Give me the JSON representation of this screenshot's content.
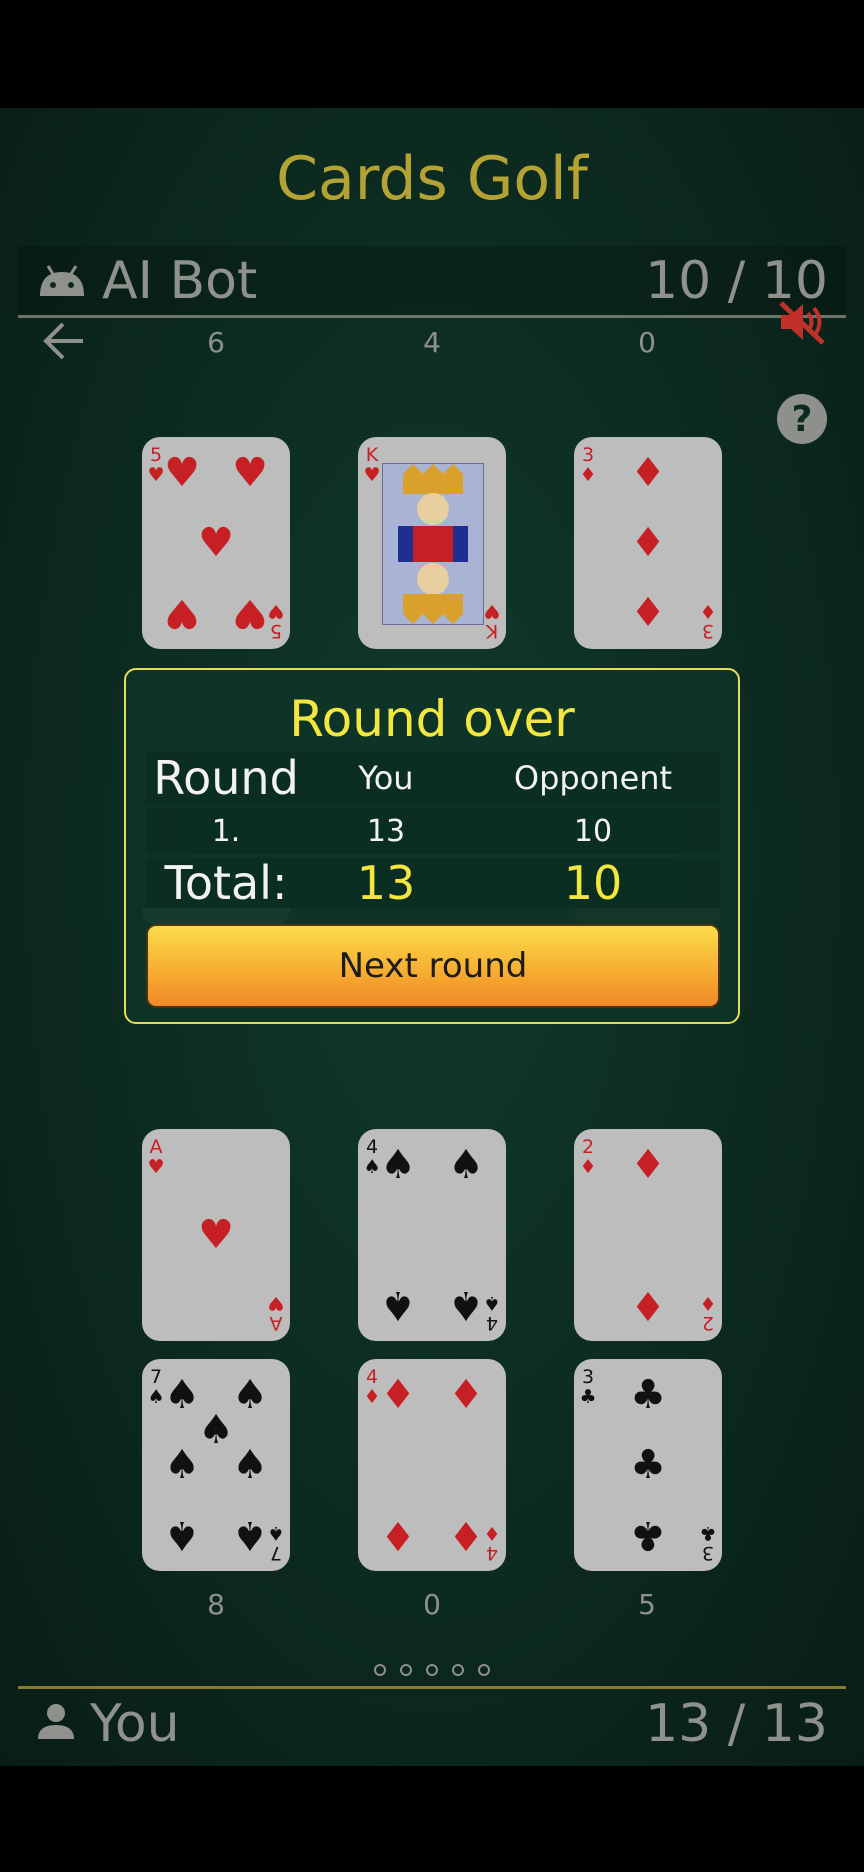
{
  "title": "Cards Golf",
  "opponent": {
    "name": "AI Bot",
    "score": "10 / 10"
  },
  "player": {
    "name": "You",
    "score": "13 / 13"
  },
  "opponent_columns": [
    "6",
    "4",
    "0"
  ],
  "player_columns": [
    "8",
    "0",
    "5"
  ],
  "icons": {
    "back": "arrow-left-icon",
    "sound": "volume-muted-icon",
    "help": "question-mark-icon",
    "bot": "android-icon",
    "user": "person-icon"
  },
  "colors": {
    "title": "#b5a235",
    "muted_icon": "#c2302a",
    "highlight": "#f3e640",
    "button_top": "#fbdc4a",
    "button_bottom": "#f08a2a"
  },
  "opponent_cards": [
    {
      "rank": "5",
      "suit": "♥"
    },
    {
      "rank": "K",
      "suit": "♥"
    },
    {
      "rank": "3",
      "suit": "♦"
    }
  ],
  "player_cards_row2": [
    {
      "rank": "A",
      "suit": "♥"
    },
    {
      "rank": "4",
      "suit": "♠"
    },
    {
      "rank": "2",
      "suit": "♦"
    }
  ],
  "player_cards_row3": [
    {
      "rank": "7",
      "suit": "♠"
    },
    {
      "rank": "4",
      "suit": "♦"
    },
    {
      "rank": "3",
      "suit": "♣"
    }
  ],
  "modal": {
    "title": "Round over",
    "headers": [
      "Round",
      "You",
      "Opponent"
    ],
    "rows": [
      {
        "round": "1.",
        "you": "13",
        "opponent": "10"
      }
    ],
    "total_label": "Total:",
    "total_you": "13",
    "total_opponent": "10",
    "button": "Next round"
  },
  "page_dots": {
    "count": 5,
    "active": 0
  }
}
